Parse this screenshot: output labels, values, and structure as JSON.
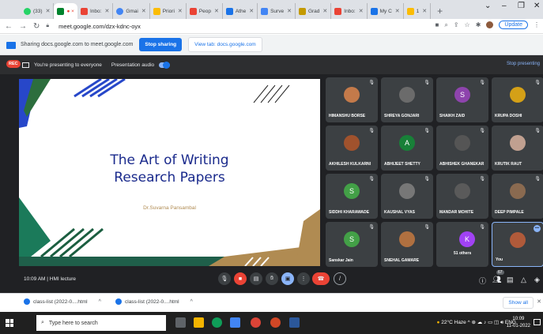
{
  "browser": {
    "tabs": [
      {
        "label": "(33)",
        "color": "#25d366",
        "active": false
      },
      {
        "label": "● ×",
        "color": "#00832d",
        "active": true
      },
      {
        "label": "Inbo:",
        "color": "#ea4335",
        "active": false
      },
      {
        "label": "Gmai",
        "color": "#4285f4",
        "active": false
      },
      {
        "label": "Priori",
        "color": "#fbbc04",
        "active": false
      },
      {
        "label": "Peop",
        "color": "#ea4335",
        "active": false
      },
      {
        "label": "Athe",
        "color": "#1a73e8",
        "active": false
      },
      {
        "label": "Surve",
        "color": "#4285f4",
        "active": false
      },
      {
        "label": "Grad",
        "color": "#c49a00",
        "active": false
      },
      {
        "label": "Inbo:",
        "color": "#ea4335",
        "active": false
      },
      {
        "label": "My C",
        "color": "#1a73e8",
        "active": false
      },
      {
        "label": "1",
        "color": "#fbbc04",
        "active": false
      }
    ],
    "new_tab": "+",
    "url": "meet.google.com/dzx-kdnc-oyx",
    "update_label": "Update"
  },
  "sharebar": {
    "text": "Sharing docs.google.com to meet.google.com",
    "stop_label": "Stop sharing",
    "view_label": "View tab: docs.google.com"
  },
  "meet": {
    "rec_label": "REC",
    "presenting_text": "You're presenting to everyone",
    "audio_label": "Presentation audio",
    "stop_presenting": "Stop presenting",
    "slide": {
      "title_line1": "The Art of Writing",
      "title_line2": "Research Papers",
      "author": "Dr.Suvarna Pansambal"
    },
    "participants": [
      {
        "name": "HIMANSHU BORSE",
        "initial": "",
        "avatar_color": "#c47a4a"
      },
      {
        "name": "SHREYA GONJARI",
        "initial": "",
        "avatar_color": "#6b6b6b"
      },
      {
        "name": "SHAIKH ZAID",
        "initial": "S",
        "avatar_color": "#8e44ad"
      },
      {
        "name": "KRUPA DOSHI",
        "initial": "",
        "avatar_color": "#d4a017"
      },
      {
        "name": "AKHILESH KULKARNI",
        "initial": "",
        "avatar_color": "#a0522d"
      },
      {
        "name": "ABHIJEET SHETTY",
        "initial": "A",
        "avatar_color": "#188038"
      },
      {
        "name": "ABHISHEK GHANEKAR",
        "initial": "",
        "avatar_color": "#555555"
      },
      {
        "name": "KRUTIK RAUT",
        "initial": "",
        "avatar_color": "#c0a090"
      },
      {
        "name": "SIDDHI KHARAWADE",
        "initial": "S",
        "avatar_color": "#43a047"
      },
      {
        "name": "KAUSHAL VYAS",
        "initial": "",
        "avatar_color": "#777777"
      },
      {
        "name": "MANDAR MOHITE",
        "initial": "",
        "avatar_color": "#5a5a5a"
      },
      {
        "name": "DEEP PIMPALE",
        "initial": "",
        "avatar_color": "#8a6a50"
      },
      {
        "name": "Sanskar Jain",
        "initial": "S",
        "avatar_color": "#43a047"
      },
      {
        "name": "SNEHAL GAMARE",
        "initial": "",
        "avatar_color": "#b07040"
      },
      {
        "name": "51 others",
        "initial": "K",
        "avatar_color": "#a142f4"
      },
      {
        "name": "You",
        "initial": "",
        "avatar_color": "#b05a3a"
      }
    ],
    "time": "10:09 AM",
    "separator": "|",
    "meeting_name": "HMI lecture",
    "badge": "67"
  },
  "downloads": {
    "items": [
      "class-list (2022-0....html",
      "class-list (2022-0....html"
    ],
    "show_all": "Show all"
  },
  "taskbar": {
    "search_placeholder": "Type here to search",
    "weather": "22°C  Haze",
    "lang": "ENG",
    "time": "10:09",
    "date": "11-01-2022"
  }
}
